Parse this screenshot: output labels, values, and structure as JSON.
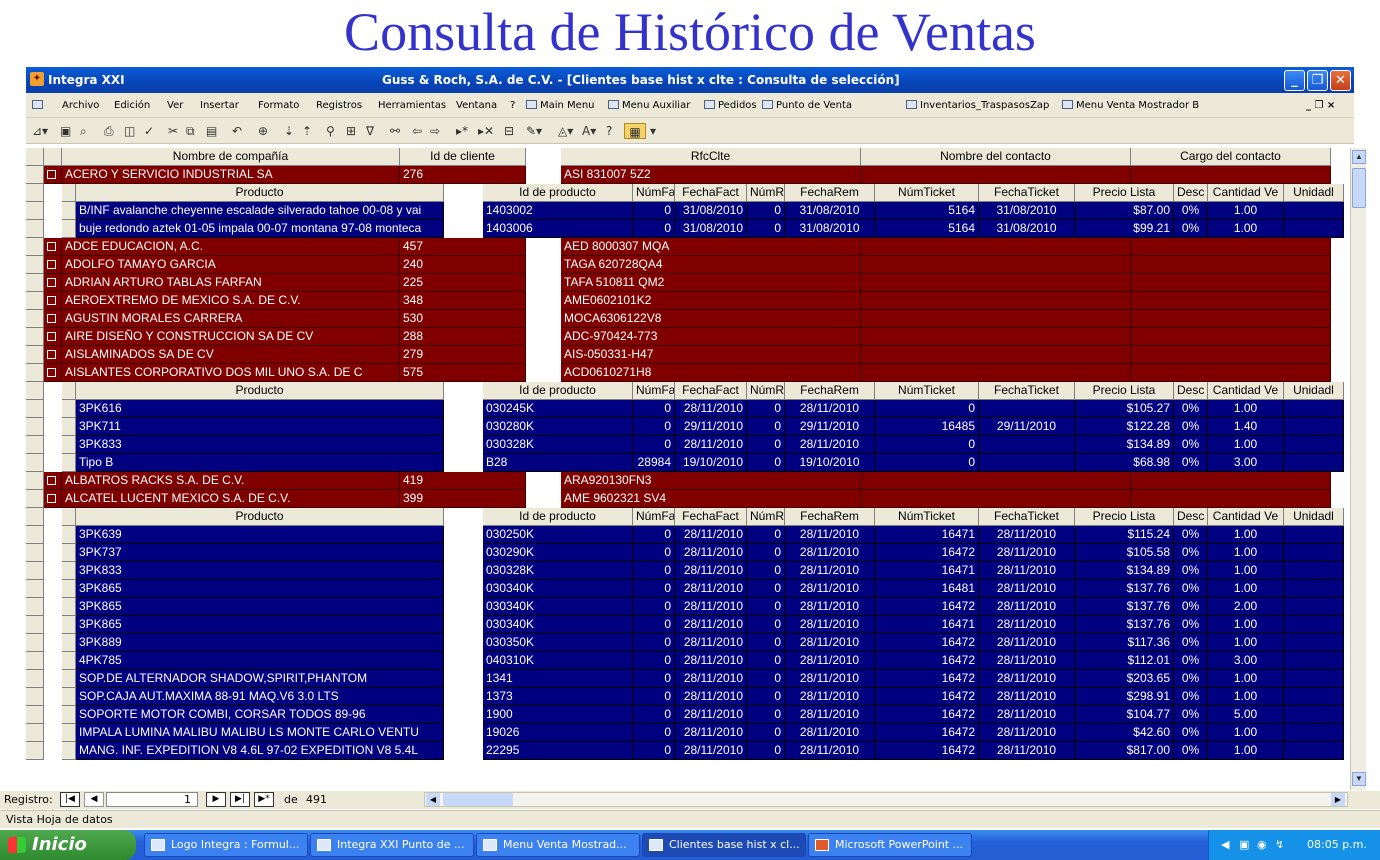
{
  "slide_title": "Consulta de Histórico de Ventas",
  "window": {
    "app_name": "Integra XXI",
    "doc_title": "Guss & Roch, S.A. de C.V. - [Clientes base hist x clte : Consulta de selección]",
    "minimize": "_",
    "restore": "❐",
    "close": "✕"
  },
  "menu": {
    "items": [
      "Archivo",
      "Edición",
      "Ver",
      "Insertar",
      "Formato",
      "Registros",
      "Herramientas",
      "Ventana",
      "?"
    ],
    "shortcuts": [
      "Main Menu",
      "Menu Auxiliar",
      "Pedidos",
      "Punto de Venta",
      "Inventarios_TraspasosZap",
      "Menu Venta Mostrador B"
    ],
    "doc_controls": "_ ❐ ×"
  },
  "toolbar": {
    "icons": [
      "view-icon",
      "save-icon",
      "search-icon",
      "print-icon",
      "print-preview-icon",
      "spelling-icon",
      "cut-icon",
      "copy-icon",
      "paste-icon",
      "undo-icon",
      "hyperlink-icon",
      "sort-asc-icon",
      "sort-desc-icon",
      "filter-selection-icon",
      "filter-form-icon",
      "apply-filter-icon",
      "find-icon",
      "prev-icon",
      "next-icon",
      "new-record-icon",
      "delete-record-icon",
      "database-window-icon",
      "new-object-icon",
      "fill-color-icon",
      "font-color-icon",
      "help-icon",
      "datasheet-icon"
    ]
  },
  "grid": {
    "headers": [
      "Nombre de compañía",
      "Id de cliente",
      "RfcClte",
      "Nombre del contacto",
      "Cargo del contacto"
    ],
    "sub_headers": [
      "Producto",
      "Id de producto",
      "NúmFact",
      "FechaFact",
      "NúmRer",
      "FechaRem",
      "NúmTicket",
      "FechaTicket",
      "Precio Lista",
      "Desc",
      "Cantidad Ve",
      "Unidadl"
    ],
    "customers": [
      {
        "name": "ACERO Y SERVICIO INDUSTRIAL SA",
        "id": "276",
        "rfc": "ASI 831007 5Z2",
        "expanded": true,
        "details": [
          [
            "B/INF avalanche cheyenne escalade silverado tahoe 00-08 y vai",
            "1403002",
            "0",
            "31/08/2010",
            "0",
            "31/08/2010",
            "5164",
            "31/08/2010",
            "$87.00",
            "0%",
            "1.00"
          ],
          [
            "buje redondo aztek 01-05 impala 00-07 montana 97-08 monteca",
            "1403006",
            "0",
            "31/08/2010",
            "0",
            "31/08/2010",
            "5164",
            "31/08/2010",
            "$99.21",
            "0%",
            "1.00"
          ]
        ]
      },
      {
        "name": "ADCE EDUCACION, A.C.",
        "id": "457",
        "rfc": "AED 8000307 MQA",
        "expanded": false,
        "details": []
      },
      {
        "name": "ADOLFO TAMAYO GARCIA",
        "id": "240",
        "rfc": "TAGA 620728QA4",
        "expanded": false,
        "details": []
      },
      {
        "name": "ADRIAN ARTURO TABLAS FARFAN",
        "id": "225",
        "rfc": "TAFA 510811 QM2",
        "expanded": false,
        "details": []
      },
      {
        "name": "AEROEXTREMO DE MEXICO S.A. DE C.V.",
        "id": "348",
        "rfc": "AME0602101K2",
        "expanded": false,
        "details": []
      },
      {
        "name": "AGUSTIN MORALES CARRERA",
        "id": "530",
        "rfc": "MOCA6306122V8",
        "expanded": false,
        "details": []
      },
      {
        "name": "AIRE DISEÑO Y CONSTRUCCION SA DE CV",
        "id": "288",
        "rfc": "ADC-970424-773",
        "expanded": false,
        "details": []
      },
      {
        "name": "AISLAMINADOS SA DE CV",
        "id": "279",
        "rfc": "AIS-050331-H47",
        "expanded": false,
        "details": []
      },
      {
        "name": "AISLANTES CORPORATIVO DOS MIL UNO S.A. DE C",
        "id": "575",
        "rfc": "ACD0610271H8",
        "expanded": true,
        "details": [
          [
            "3PK616",
            "030245K",
            "0",
            "28/11/2010",
            "0",
            "28/11/2010",
            "0",
            "",
            "$105.27",
            "0%",
            "1.00"
          ],
          [
            "3PK711",
            "030280K",
            "0",
            "29/11/2010",
            "0",
            "29/11/2010",
            "16485",
            "29/11/2010",
            "$122.28",
            "0%",
            "1.40"
          ],
          [
            "3PK833",
            "030328K",
            "0",
            "28/11/2010",
            "0",
            "28/11/2010",
            "0",
            "",
            "$134.89",
            "0%",
            "1.00"
          ],
          [
            "Tipo B",
            "B28",
            "28984",
            "19/10/2010",
            "0",
            "19/10/2010",
            "0",
            "",
            "$68.98",
            "0%",
            "3.00"
          ]
        ]
      },
      {
        "name": "ALBATROS RACKS S.A. DE C.V.",
        "id": "419",
        "rfc": "ARA920130FN3",
        "expanded": false,
        "details": []
      },
      {
        "name": "ALCATEL LUCENT MEXICO S.A. DE C.V.",
        "id": "399",
        "rfc": "AME 9602321 SV4",
        "expanded": true,
        "details": [
          [
            "3PK639",
            "030250K",
            "0",
            "28/11/2010",
            "0",
            "28/11/2010",
            "16471",
            "28/11/2010",
            "$115.24",
            "0%",
            "1.00"
          ],
          [
            "3PK737",
            "030290K",
            "0",
            "28/11/2010",
            "0",
            "28/11/2010",
            "16472",
            "28/11/2010",
            "$105.58",
            "0%",
            "1.00"
          ],
          [
            "3PK833",
            "030328K",
            "0",
            "28/11/2010",
            "0",
            "28/11/2010",
            "16471",
            "28/11/2010",
            "$134.89",
            "0%",
            "1.00"
          ],
          [
            "3PK865",
            "030340K",
            "0",
            "28/11/2010",
            "0",
            "28/11/2010",
            "16481",
            "28/11/2010",
            "$137.76",
            "0%",
            "1.00"
          ],
          [
            "3PK865",
            "030340K",
            "0",
            "28/11/2010",
            "0",
            "28/11/2010",
            "16472",
            "28/11/2010",
            "$137.76",
            "0%",
            "2.00"
          ],
          [
            "3PK865",
            "030340K",
            "0",
            "28/11/2010",
            "0",
            "28/11/2010",
            "16471",
            "28/11/2010",
            "$137.76",
            "0%",
            "1.00"
          ],
          [
            "3PK889",
            "030350K",
            "0",
            "28/11/2010",
            "0",
            "28/11/2010",
            "16472",
            "28/11/2010",
            "$117.36",
            "0%",
            "1.00"
          ],
          [
            "4PK785",
            "040310K",
            "0",
            "28/11/2010",
            "0",
            "28/11/2010",
            "16472",
            "28/11/2010",
            "$112.01",
            "0%",
            "3.00"
          ],
          [
            "SOP.DE ALTERNADOR SHADOW,SPIRIT,PHANTOM",
            "1341",
            "0",
            "28/11/2010",
            "0",
            "28/11/2010",
            "16472",
            "28/11/2010",
            "$203.65",
            "0%",
            "1.00"
          ],
          [
            "SOP.CAJA AUT.MAXIMA 88-91 MAQ.V6 3.0 LTS",
            "1373",
            "0",
            "28/11/2010",
            "0",
            "28/11/2010",
            "16472",
            "28/11/2010",
            "$298.91",
            "0%",
            "1.00"
          ],
          [
            "SOPORTE MOTOR COMBI, CORSAR TODOS 89-96",
            "1900",
            "0",
            "28/11/2010",
            "0",
            "28/11/2010",
            "16472",
            "28/11/2010",
            "$104.77",
            "0%",
            "5.00"
          ],
          [
            "IMPALA LUMINA MALIBU MALIBU LS MONTE CARLO VENTU",
            "19026",
            "0",
            "28/11/2010",
            "0",
            "28/11/2010",
            "16472",
            "28/11/2010",
            "$42.60",
            "0%",
            "1.00"
          ],
          [
            "MANG. INF. EXPEDITION V8 4.6L 97-02 EXPEDITION V8 5.4L",
            "22295",
            "0",
            "28/11/2010",
            "0",
            "28/11/2010",
            "16472",
            "28/11/2010",
            "$817.00",
            "0%",
            "1.00"
          ]
        ]
      }
    ]
  },
  "nav": {
    "label": "Registro:",
    "current": "1",
    "of_label": "de",
    "total": "491",
    "first": "|◀",
    "prev": "◀",
    "next": "▶",
    "last": "▶|",
    "new": "▶*"
  },
  "status": "Vista Hoja de datos",
  "taskbar": {
    "start_label": "Inicio",
    "tasks": [
      "Logo Integra : Formul...",
      "Integra XXI Punto de ...",
      "Menu Venta Mostrad...",
      "Clientes base hist x cl...",
      "Microsoft PowerPoint ..."
    ],
    "active_task_index": 3,
    "clock": "08:05 p.m."
  },
  "colors": {
    "customer_row": "#800000",
    "detail_row": "#000080",
    "title": "#3333cc"
  }
}
